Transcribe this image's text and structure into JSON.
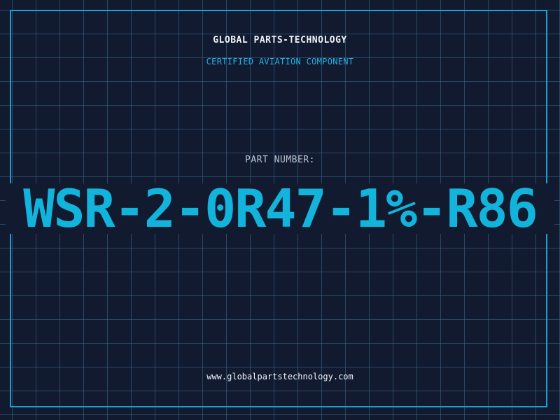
{
  "header": {
    "company_name": "GLOBAL PARTS-TECHNOLOGY",
    "tagline": "CERTIFIED AVIATION COMPONENT"
  },
  "part": {
    "label": "PART NUMBER:",
    "number": "WSR-2-0R47-1%-R86"
  },
  "footer": {
    "website": "www.globalpartstechnology.com"
  },
  "colors": {
    "background": "#121a30",
    "grid": "#3a6e8c",
    "frame": "#1aa0d8",
    "accent": "#12b4dc",
    "text": "#f0f4f8"
  }
}
